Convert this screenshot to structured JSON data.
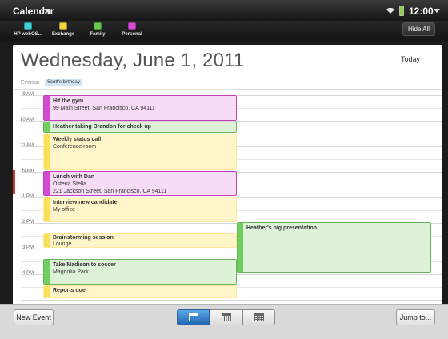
{
  "status_bar": {
    "app_name": "Calendar",
    "time": "12:00"
  },
  "calendars": [
    {
      "label": "HP webOS...",
      "color": "#3fd3d6"
    },
    {
      "label": "Exchange",
      "color": "#f5d53d"
    },
    {
      "label": "Family",
      "color": "#62c94f"
    },
    {
      "label": "Personal",
      "color": "#d74bd6"
    }
  ],
  "hide_all_label": "Hide All",
  "day_view": {
    "title": "Wednesday, June 1, 2011",
    "today_label": "Today",
    "events_label": "Events:",
    "all_day_event": "Scott's birthday",
    "hours": [
      "9 AM",
      "10 AM",
      "11 AM",
      "Noon",
      "1 PM",
      "2 PM",
      "3 PM",
      "4 PM"
    ],
    "events": [
      {
        "title": "Hit the gym",
        "line1": "99 Main Street, San Francisco, CA 94111",
        "line2": "",
        "calendar": "Personal"
      },
      {
        "title": "Heather taking Brandon for check up",
        "line1": "",
        "line2": "",
        "calendar": "Family"
      },
      {
        "title": "Weekly status call",
        "line1": "Conference room",
        "line2": "",
        "calendar": "Exchange"
      },
      {
        "title": "Lunch with Dan",
        "line1": "Osteria Stella",
        "line2": "221 Jackson Street, San Francisco, CA 94111",
        "calendar": "Personal"
      },
      {
        "title": "Interview new candidate",
        "line1": "My office",
        "line2": "",
        "calendar": "Exchange"
      },
      {
        "title": "Brainstorming session",
        "line1": "Lounge",
        "line2": "",
        "calendar": "Exchange"
      },
      {
        "title": "Take Madison to soccer",
        "line1": "Magnolia Park",
        "line2": "",
        "calendar": "Family"
      },
      {
        "title": "Reports due",
        "line1": "",
        "line2": "",
        "calendar": "Exchange"
      },
      {
        "title": "Heather's big presentation",
        "line1": "",
        "line2": "",
        "calendar": "Family"
      }
    ]
  },
  "toolbar": {
    "new_event_label": "New Event",
    "jump_to_label": "Jump to...",
    "active_view": "Day"
  }
}
